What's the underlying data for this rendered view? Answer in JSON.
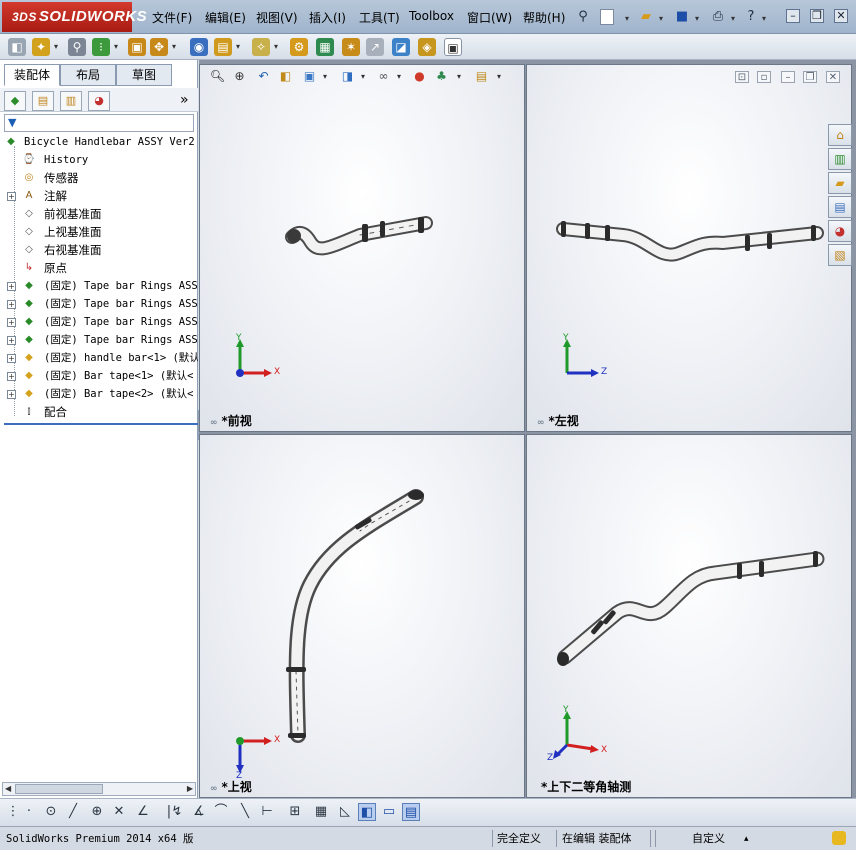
{
  "app": {
    "logo_text": "SOLIDWORKS",
    "logo_prefix": "3DS"
  },
  "menu": {
    "items": [
      "文件(F)",
      "编辑(E)",
      "视图(V)",
      "插入(I)",
      "工具(T)",
      "Toolbox",
      "窗口(W)",
      "帮助(H)"
    ]
  },
  "panel": {
    "tabs": [
      "装配体",
      "布局",
      "草图"
    ],
    "active_tab": "装配体",
    "more_glyph": "»"
  },
  "tree": {
    "root": "Bicycle Handlebar ASSY Ver2",
    "items": [
      {
        "label": "History",
        "icon": "history-icon",
        "expandable": false
      },
      {
        "label": "传感器",
        "icon": "sensor-icon",
        "expandable": false
      },
      {
        "label": "注解",
        "icon": "annotation-icon",
        "expandable": true
      },
      {
        "label": "前视基准面",
        "icon": "plane-icon",
        "expandable": false
      },
      {
        "label": "上视基准面",
        "icon": "plane-icon",
        "expandable": false
      },
      {
        "label": "右视基准面",
        "icon": "plane-icon",
        "expandable": false
      },
      {
        "label": "原点",
        "icon": "origin-icon",
        "expandable": false
      },
      {
        "label": "(固定) Tape bar Rings ASSY",
        "icon": "subassembly-icon",
        "expandable": true
      },
      {
        "label": "(固定) Tape bar Rings ASSY",
        "icon": "subassembly-icon",
        "expandable": true
      },
      {
        "label": "(固定) Tape bar Rings ASSY",
        "icon": "subassembly-icon",
        "expandable": true
      },
      {
        "label": "(固定) Tape bar Rings ASSY",
        "icon": "subassembly-icon",
        "expandable": true
      },
      {
        "label": "(固定) handle bar<1> (默认<",
        "icon": "part-icon",
        "expandable": true
      },
      {
        "label": "(固定) Bar tape<1> (默认<",
        "icon": "part-icon",
        "expandable": true
      },
      {
        "label": "(固定) Bar tape<2> (默认<",
        "icon": "part-icon",
        "expandable": true
      },
      {
        "label": "配合",
        "icon": "mates-icon",
        "expandable": false
      }
    ]
  },
  "viewports": [
    {
      "label": "*前视",
      "axes": [
        "Y",
        "X"
      ]
    },
    {
      "label": "*左视",
      "axes": [
        "Y",
        "Z"
      ]
    },
    {
      "label": "*上视",
      "axes": [
        "X",
        "Z"
      ]
    },
    {
      "label": "*上下二等角轴测",
      "axes": [
        "Y",
        "X",
        "Z"
      ]
    }
  ],
  "statusbar": {
    "product": "SolidWorks Premium 2014 x64 版",
    "definition": "完全定义",
    "editing": "在编辑 装配体",
    "units": "自定义",
    "units_arrow": "▴"
  },
  "colors": {
    "accent": "#3d6ebd",
    "logo_red": "#c0281f",
    "axis_x": "#d22020",
    "axis_y": "#1f9a2a",
    "axis_z": "#2030c0"
  }
}
